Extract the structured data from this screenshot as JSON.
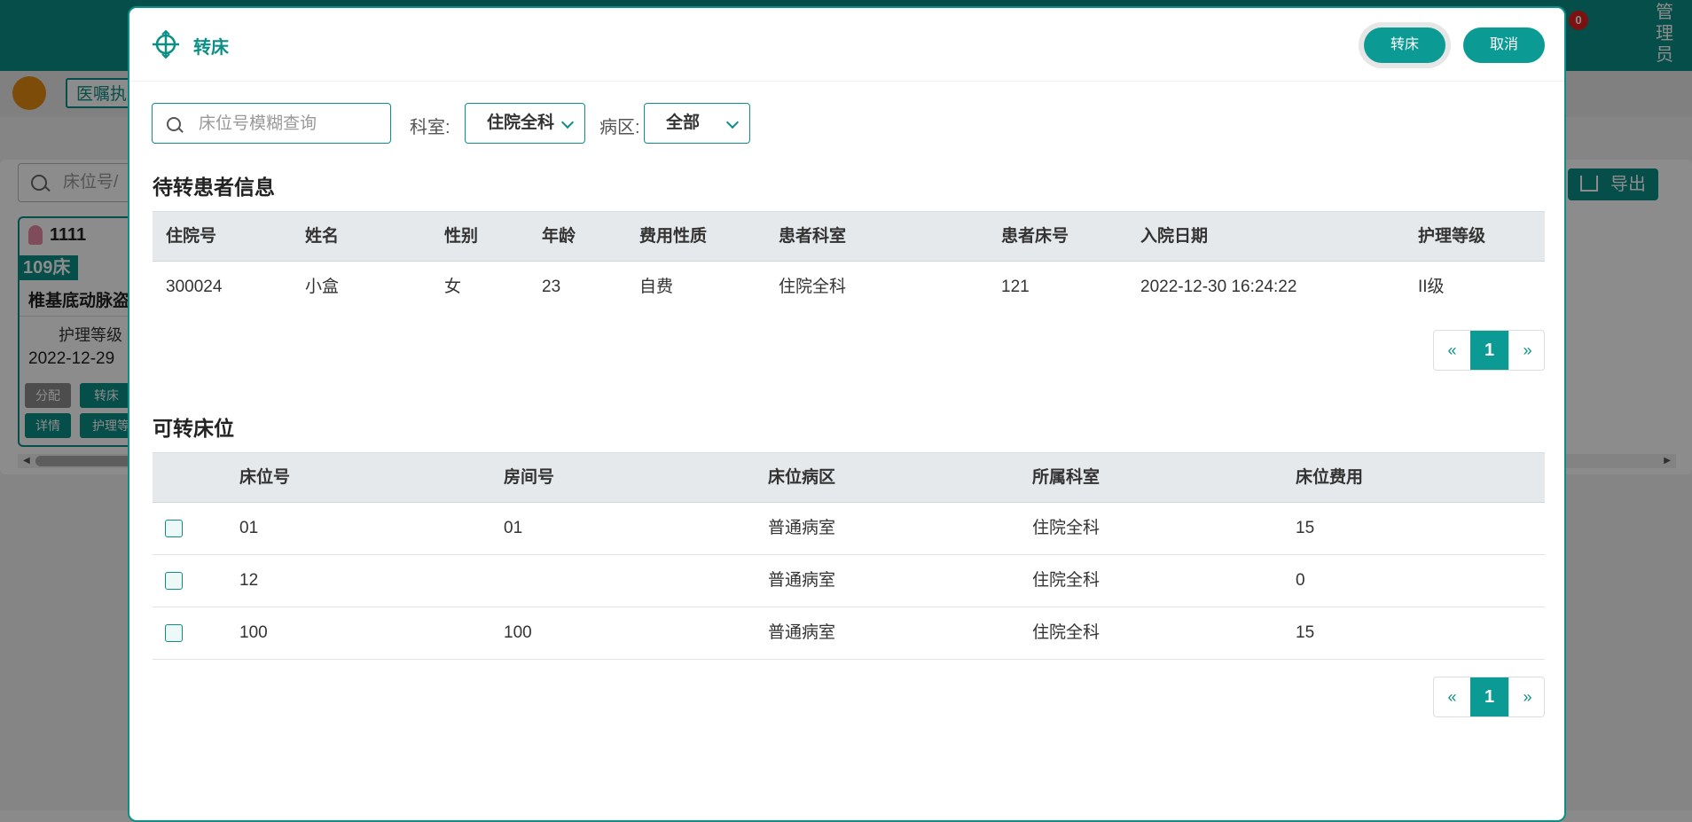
{
  "background": {
    "badge_count": "0",
    "user_label": "管理员",
    "tab_label": "医嘱执",
    "search_placeholder": "床位号/",
    "export_label": "导出",
    "card": {
      "name": "1111",
      "bed": "109床",
      "diagnosis": "椎基底动脉盗",
      "level": "护理等级",
      "date": "2022-12-29",
      "btn_assign": "分配",
      "btn_transfer": "转床",
      "btn_detail": "详情",
      "btn_nursing": "护理等"
    }
  },
  "modal": {
    "title": "转床",
    "confirm_label": "转床",
    "cancel_label": "取消",
    "search_placeholder": "床位号模糊查询",
    "dept_label": "科室:",
    "dept_value": "住院全科",
    "ward_label": "病区:",
    "ward_value": "全部",
    "pending": {
      "title": "待转患者信息",
      "columns": [
        "住院号",
        "姓名",
        "性别",
        "年龄",
        "费用性质",
        "患者科室",
        "患者床号",
        "入院日期",
        "护理等级"
      ],
      "rows": [
        [
          "300024",
          "小盒",
          "女",
          "23",
          "自费",
          "住院全科",
          "121",
          "2022-12-30 16:24:22",
          "II级"
        ]
      ],
      "pager": {
        "prev": "«",
        "current": "1",
        "next": "»"
      }
    },
    "beds": {
      "title": "可转床位",
      "columns": [
        "床位号",
        "房间号",
        "床位病区",
        "所属科室",
        "床位费用"
      ],
      "rows": [
        [
          "01",
          "01",
          "普通病室",
          "住院全科",
          "15"
        ],
        [
          "12",
          "",
          "普通病室",
          "住院全科",
          "0"
        ],
        [
          "100",
          "100",
          "普通病室",
          "住院全科",
          "15"
        ]
      ],
      "pager": {
        "prev": "«",
        "current": "1",
        "next": "»"
      }
    }
  },
  "colors": {
    "accent": "#0b8f86",
    "button": "#0b9b94",
    "header_bg": "#e6e9ec"
  }
}
